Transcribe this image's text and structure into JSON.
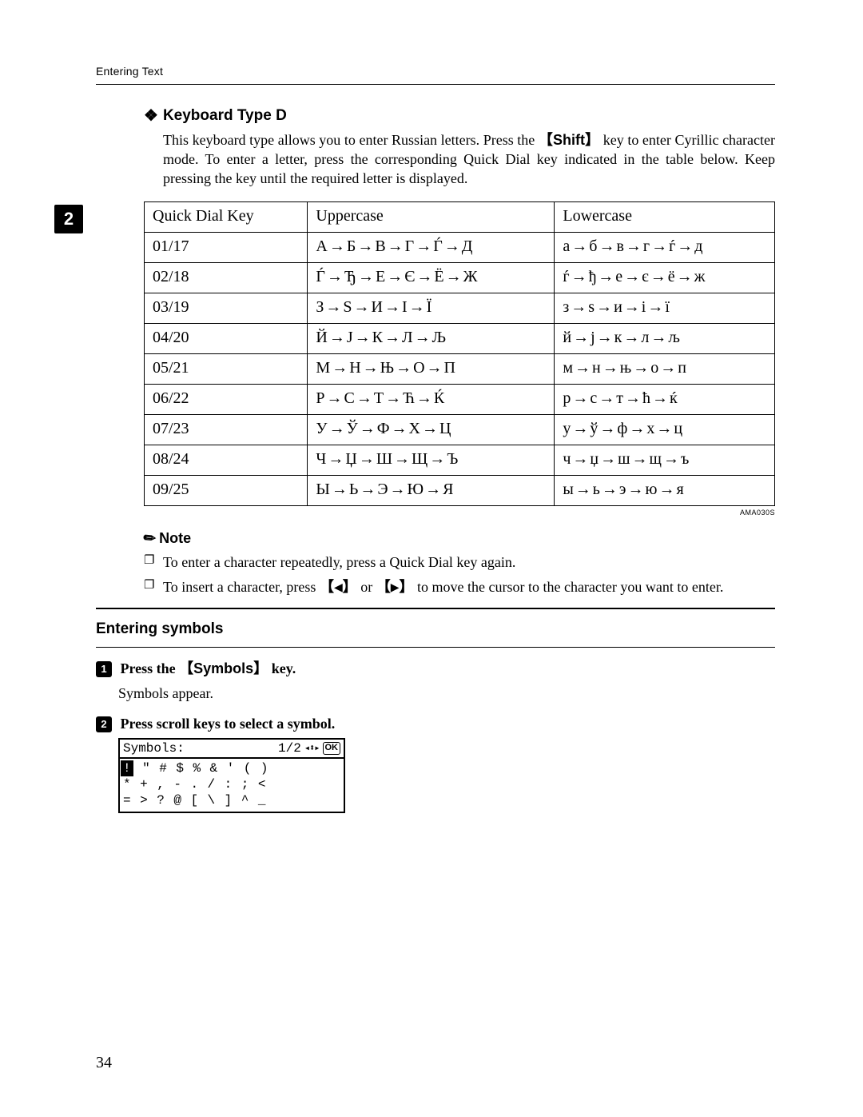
{
  "running_head": "Entering Text",
  "chapter_tab": "2",
  "keyboard": {
    "heading": "Keyboard Type D",
    "body_pre": "This keyboard type allows you to enter Russian letters. Press the ",
    "shift_key": "Shift",
    "body_post": " key to enter Cyrillic character mode. To enter a letter, press the corresponding Quick Dial key indicated in the table below. Keep pressing the key until the required letter is displayed."
  },
  "table": {
    "headers": [
      "Quick Dial Key",
      "Uppercase",
      "Lowercase"
    ],
    "rows": [
      {
        "key": "01/17",
        "upper": [
          "А",
          "Б",
          "В",
          "Г",
          "Ѓ",
          "Д"
        ],
        "lower": [
          "а",
          "б",
          "в",
          "г",
          "ѓ",
          "д"
        ]
      },
      {
        "key": "02/18",
        "upper": [
          "Ѓ",
          "Ђ",
          "Е",
          "Є",
          "Ё",
          "Ж"
        ],
        "lower": [
          "ѓ",
          "ђ",
          "е",
          "є",
          "ё",
          "ж"
        ]
      },
      {
        "key": "03/19",
        "upper": [
          "З",
          "Ѕ",
          "И",
          "І",
          "Ї"
        ],
        "lower": [
          "з",
          "ѕ",
          "и",
          "і",
          "ї"
        ]
      },
      {
        "key": "04/20",
        "upper": [
          "Й",
          "Ј",
          "К",
          "Л",
          "Љ"
        ],
        "lower": [
          "й",
          "ј",
          "к",
          "л",
          "љ"
        ]
      },
      {
        "key": "05/21",
        "upper": [
          "М",
          "Н",
          "Њ",
          "О",
          "П"
        ],
        "lower": [
          "м",
          "н",
          "њ",
          "о",
          "п"
        ]
      },
      {
        "key": "06/22",
        "upper": [
          "Р",
          "С",
          "Т",
          "Ћ",
          "Ќ"
        ],
        "lower": [
          "р",
          "с",
          "т",
          "ћ",
          "ќ"
        ]
      },
      {
        "key": "07/23",
        "upper": [
          "У",
          "Ў",
          "Ф",
          "Х",
          "Ц"
        ],
        "lower": [
          "у",
          "ў",
          "ф",
          "х",
          "ц"
        ]
      },
      {
        "key": "08/24",
        "upper": [
          "Ч",
          "Џ",
          "Ш",
          "Щ",
          "Ъ"
        ],
        "lower": [
          "ч",
          "џ",
          "ш",
          "щ",
          "ъ"
        ]
      },
      {
        "key": "09/25",
        "upper": [
          "Ы",
          "Ь",
          "Э",
          "Ю",
          "Я"
        ],
        "lower": [
          "ы",
          "ь",
          "э",
          "ю",
          "я"
        ]
      }
    ]
  },
  "image_code": "AMA030S",
  "note": {
    "heading": "Note",
    "item1": "To enter a character repeatedly, press a Quick Dial key again.",
    "item2_pre": "To insert a character, press ",
    "item2_mid": " or ",
    "item2_post": " to move the cursor to the character you want to enter."
  },
  "symbols_section": {
    "heading": "Entering symbols",
    "step1_pre": "Press the ",
    "step1_key": "Symbols",
    "step1_post": " key.",
    "step1_body": "Symbols appear.",
    "step2": "Press scroll keys to select a symbol."
  },
  "lcd": {
    "title": "Symbols:",
    "page": "1/2",
    "ok": "OK",
    "rows": [
      [
        "!",
        "\"",
        "#",
        "$",
        "%",
        "&",
        "'",
        "(",
        ")"
      ],
      [
        "*",
        "+",
        ",",
        "-",
        ".",
        "/",
        ":",
        ";",
        "<"
      ],
      [
        "=",
        ">",
        "?",
        "@",
        "[",
        "\\",
        "]",
        "^",
        "_"
      ]
    ],
    "selected": [
      0,
      0
    ]
  },
  "page_number": "34"
}
